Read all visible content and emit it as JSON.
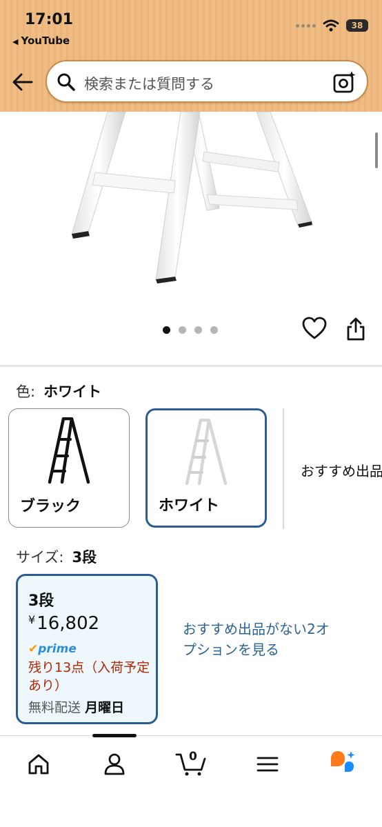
{
  "status_bar": {
    "time": "17:01",
    "back_app": "YouTube",
    "battery": "38"
  },
  "search": {
    "placeholder": "検索または質問する"
  },
  "gallery": {
    "image_count": 4,
    "active_index": 0
  },
  "color": {
    "label": "色:",
    "selected": "ホワイト",
    "options": [
      {
        "label": "ブラック",
        "swatch": "#111111"
      },
      {
        "label": "ホワイト",
        "swatch": "#f4f4f4"
      }
    ],
    "more_options": "おすすめ出品"
  },
  "size": {
    "label": "サイズ:",
    "selected": "3段",
    "card": {
      "name": "3段",
      "price_symbol": "¥",
      "price": "16,802",
      "prime_label": "prime",
      "stock": "残り13点（入荷予定あり）",
      "delivery_prefix": "無料配送",
      "delivery_day": "月曜日"
    },
    "more_options": "おすすめ出品がない2オプションを見る"
  },
  "bottom_nav": {
    "items": [
      "home-icon",
      "account-icon",
      "cart-icon",
      "menu-icon",
      "rufus-icon"
    ],
    "cart_count": "0"
  },
  "colors": {
    "header": "#efbd84",
    "selected_border": "#2a5e93",
    "link": "#2a6496",
    "stock": "#b12704",
    "prime": "#2d8cd9"
  }
}
